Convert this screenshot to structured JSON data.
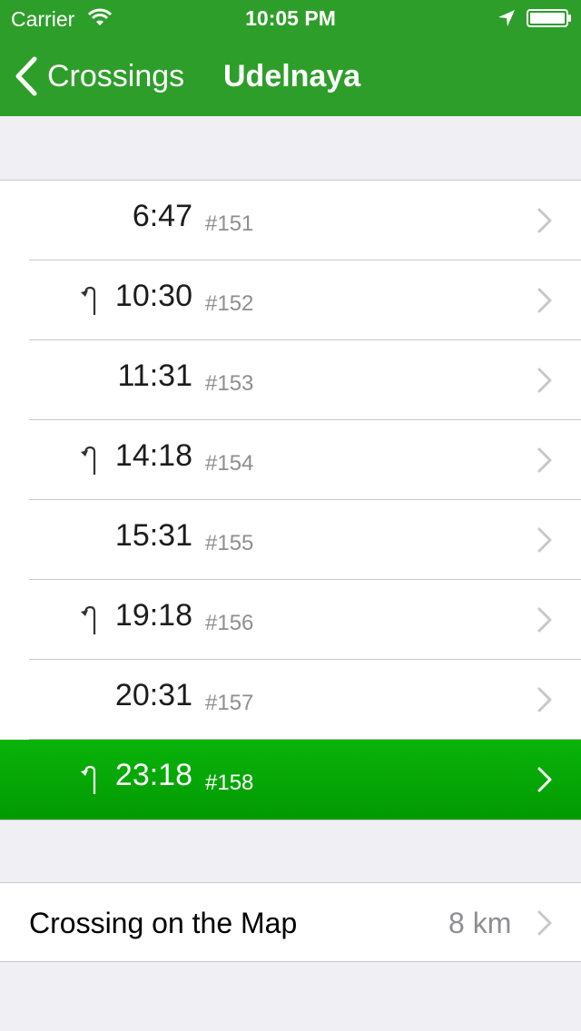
{
  "status_bar": {
    "carrier": "Carrier",
    "time": "10:05 PM"
  },
  "nav": {
    "back_label": "Crossings",
    "title": "Udelnaya"
  },
  "crossings": [
    {
      "time": "6:47",
      "number": "#151",
      "marked": false,
      "selected": false
    },
    {
      "time": "10:30",
      "number": "#152",
      "marked": true,
      "selected": false
    },
    {
      "time": "11:31",
      "number": "#153",
      "marked": false,
      "selected": false
    },
    {
      "time": "14:18",
      "number": "#154",
      "marked": true,
      "selected": false
    },
    {
      "time": "15:31",
      "number": "#155",
      "marked": false,
      "selected": false
    },
    {
      "time": "19:18",
      "number": "#156",
      "marked": true,
      "selected": false
    },
    {
      "time": "20:31",
      "number": "#157",
      "marked": false,
      "selected": false
    },
    {
      "time": "23:18",
      "number": "#158",
      "marked": true,
      "selected": true
    }
  ],
  "map_row": {
    "label": "Crossing on the Map",
    "distance": "8 km"
  },
  "colors": {
    "nav_bar": "#2e9e2a",
    "selected_row": "#029a02",
    "background": "#efeff4"
  },
  "icons": {
    "back": "chevron-left-icon",
    "row_mark": "return-arrow-icon",
    "disclosure": "chevron-right-icon"
  }
}
